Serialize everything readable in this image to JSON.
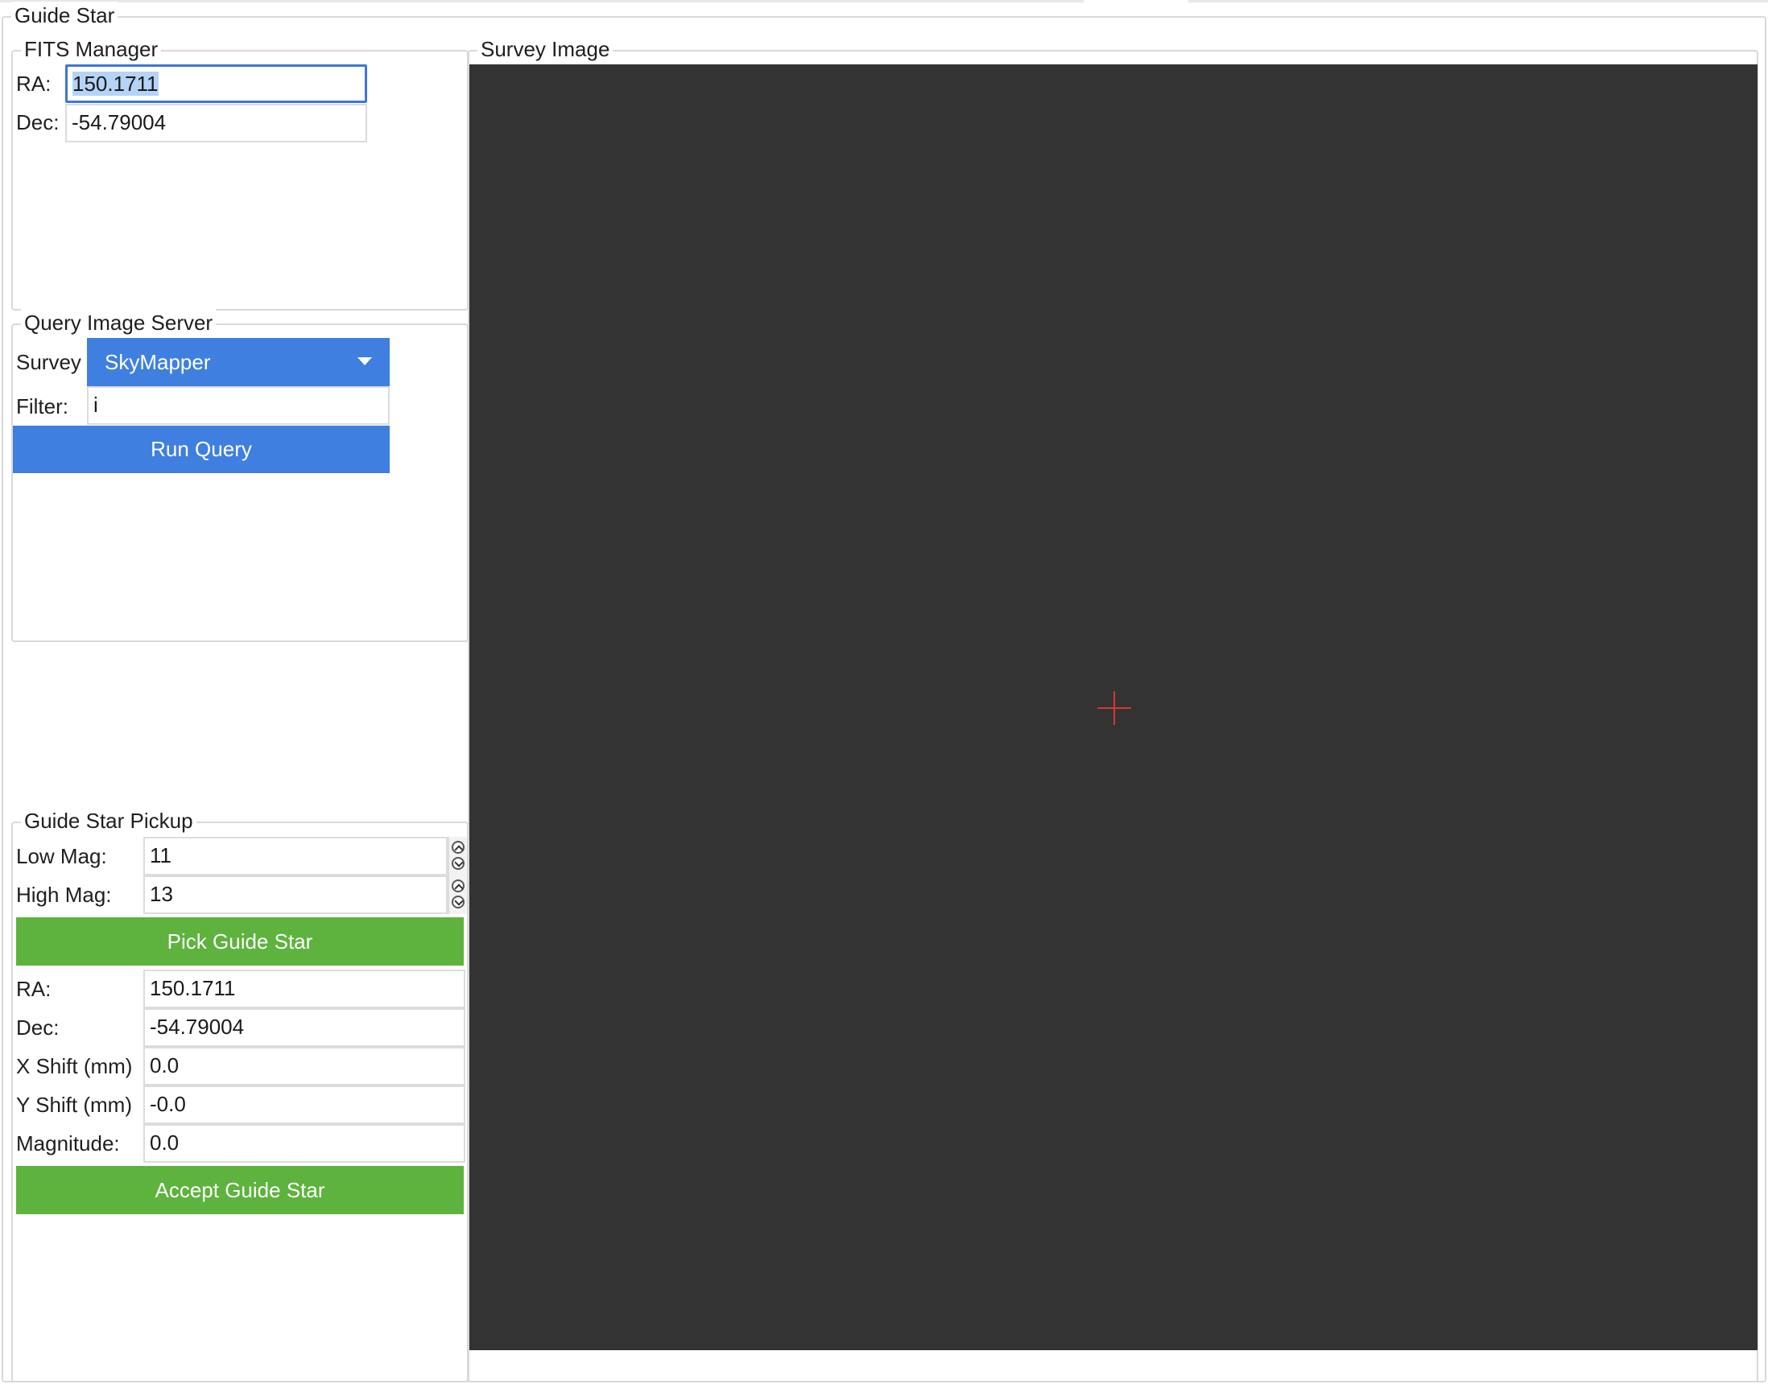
{
  "window": {
    "title": "Guide Star"
  },
  "fits_manager": {
    "title": "FITS Manager",
    "ra_label": "RA:",
    "ra_value": "150.1711",
    "dec_label": "Dec:",
    "dec_value": "-54.79004"
  },
  "query_image_server": {
    "title": "Query Image Server",
    "survey_label": "Survey",
    "survey_selected": "SkyMapper",
    "filter_label": "Filter:",
    "filter_value": "i",
    "run_query_label": "Run Query"
  },
  "guide_star_pickup": {
    "title": "Guide Star Pickup",
    "low_mag_label": "Low Mag:",
    "low_mag_value": "11",
    "high_mag_label": "High Mag:",
    "high_mag_value": "13",
    "pick_button_label": "Pick Guide Star",
    "ra_label": "RA:",
    "ra_value": "150.1711",
    "dec_label": "Dec:",
    "dec_value": "-54.79004",
    "x_shift_label": "X Shift (mm)",
    "x_shift_value": "0.0",
    "y_shift_label": "Y Shift (mm)",
    "y_shift_value": "-0.0",
    "magnitude_label": "Magnitude:",
    "magnitude_value": "0.0",
    "accept_button_label": "Accept Guide Star"
  },
  "survey_image": {
    "title": "Survey Image",
    "background_color": "#333333",
    "crosshair_color": "#d93535"
  },
  "colors": {
    "accent_blue": "#3f7fe0",
    "accent_green": "#5db33d",
    "focus_border": "#3c78d8",
    "selection": "#b5d3f7"
  },
  "icons": {
    "dropdown": "chevron-down-icon",
    "spinner_up": "chevron-up-icon",
    "spinner_down": "chevron-down-icon",
    "crosshair": "crosshair-icon"
  }
}
